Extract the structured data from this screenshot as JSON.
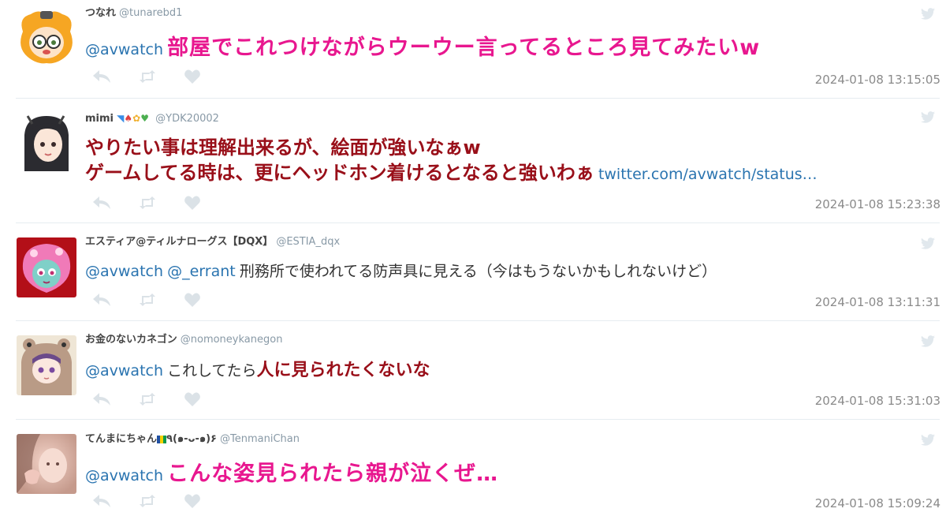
{
  "tweets": [
    {
      "name": "つなれ",
      "handle": "@tunarebd1",
      "mention": "@avwatch",
      "text": "部屋でこれつけながらウーウー言ってるところ見てみたいw",
      "time": "2024-01-08 13:15:05"
    },
    {
      "name": "mimi",
      "emoji": [
        "dolphin-emoji",
        "mushroom-emoji",
        "flower-emoji",
        "green-heart-emoji"
      ],
      "handle": "@YDK20002",
      "line1": "やりたい事は理解出来るが、絵面が強いなぁw",
      "line2": "ゲームしてる時は、更にヘッドホン着けるとなると強いわぁ",
      "link": "twitter.com/avwatch/status…",
      "time": "2024-01-08 15:23:38"
    },
    {
      "name": "エスティア@ティルナローグス【DQX】",
      "handle": "@ESTIA_dqx",
      "mention": "@avwatch",
      "mention2": "@_errant",
      "text": "刑務所で使われてる防声具に見える（今はもうないかもしれないけど）",
      "time": "2024-01-08 13:11:31"
    },
    {
      "name": "お金のないカネゴン",
      "handle": "@nomoneykanegon",
      "mention": "@avwatch",
      "text_plain": "これしてたら",
      "text_bold": "人に見られたくないな",
      "time": "2024-01-08 15:31:03"
    },
    {
      "name": "てんまにちゃん",
      "name_suffix": "٩(๑-ᴗ-๑)۶",
      "flag": "saint-vincent-flag-emoji",
      "handle": "@TenmaniChan",
      "mention": "@avwatch",
      "text": "こんな姿見られたら親が泣くぜ…",
      "time": "2024-01-08 15:09:24"
    }
  ],
  "colors": {
    "mention": "#2a74b0",
    "pink_text": "#e8178f",
    "dark_red_text": "#990f19",
    "muted": "#8899a6",
    "divider": "#e6ecf0"
  },
  "icons": {
    "reply": "reply-icon",
    "retweet": "retweet-icon",
    "like": "heart-icon",
    "brand": "twitter-bird-icon"
  }
}
